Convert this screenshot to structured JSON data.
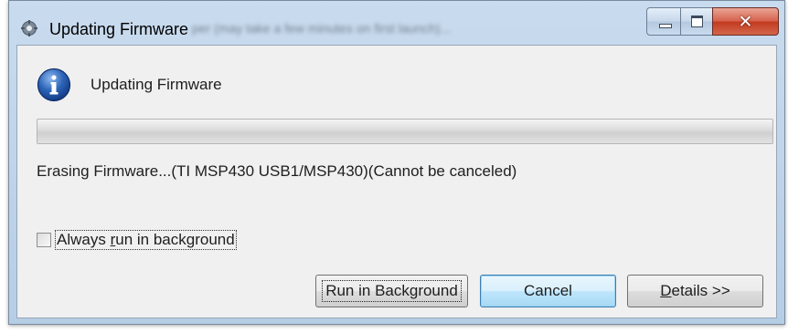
{
  "window": {
    "title": "Updating Firmware",
    "title_obscured": "per (may take a few minutes on first launch)..."
  },
  "dialog": {
    "heading": "Updating Firmware",
    "progress_fraction": 0.0,
    "status": "Erasing Firmware...(TI MSP430 USB1/MSP430)(Cannot be canceled)",
    "checkbox": {
      "label_pre": "Always ",
      "label_mnemonic": "r",
      "label_post": "un in background",
      "checked": false
    },
    "buttons": {
      "run_in_background": "Run in Background",
      "cancel": "Cancel",
      "details_mnemonic": "D",
      "details_rest": "etails >>"
    }
  },
  "icons": {
    "app": "app-gear-icon",
    "info": "info-icon",
    "minimize": "minimize-icon",
    "maximize": "maximize-icon",
    "close": "close-icon"
  },
  "colors": {
    "info_blue": "#2d64b8",
    "close_red": "#c23a1f",
    "client_bg": "#f0f0f0"
  }
}
